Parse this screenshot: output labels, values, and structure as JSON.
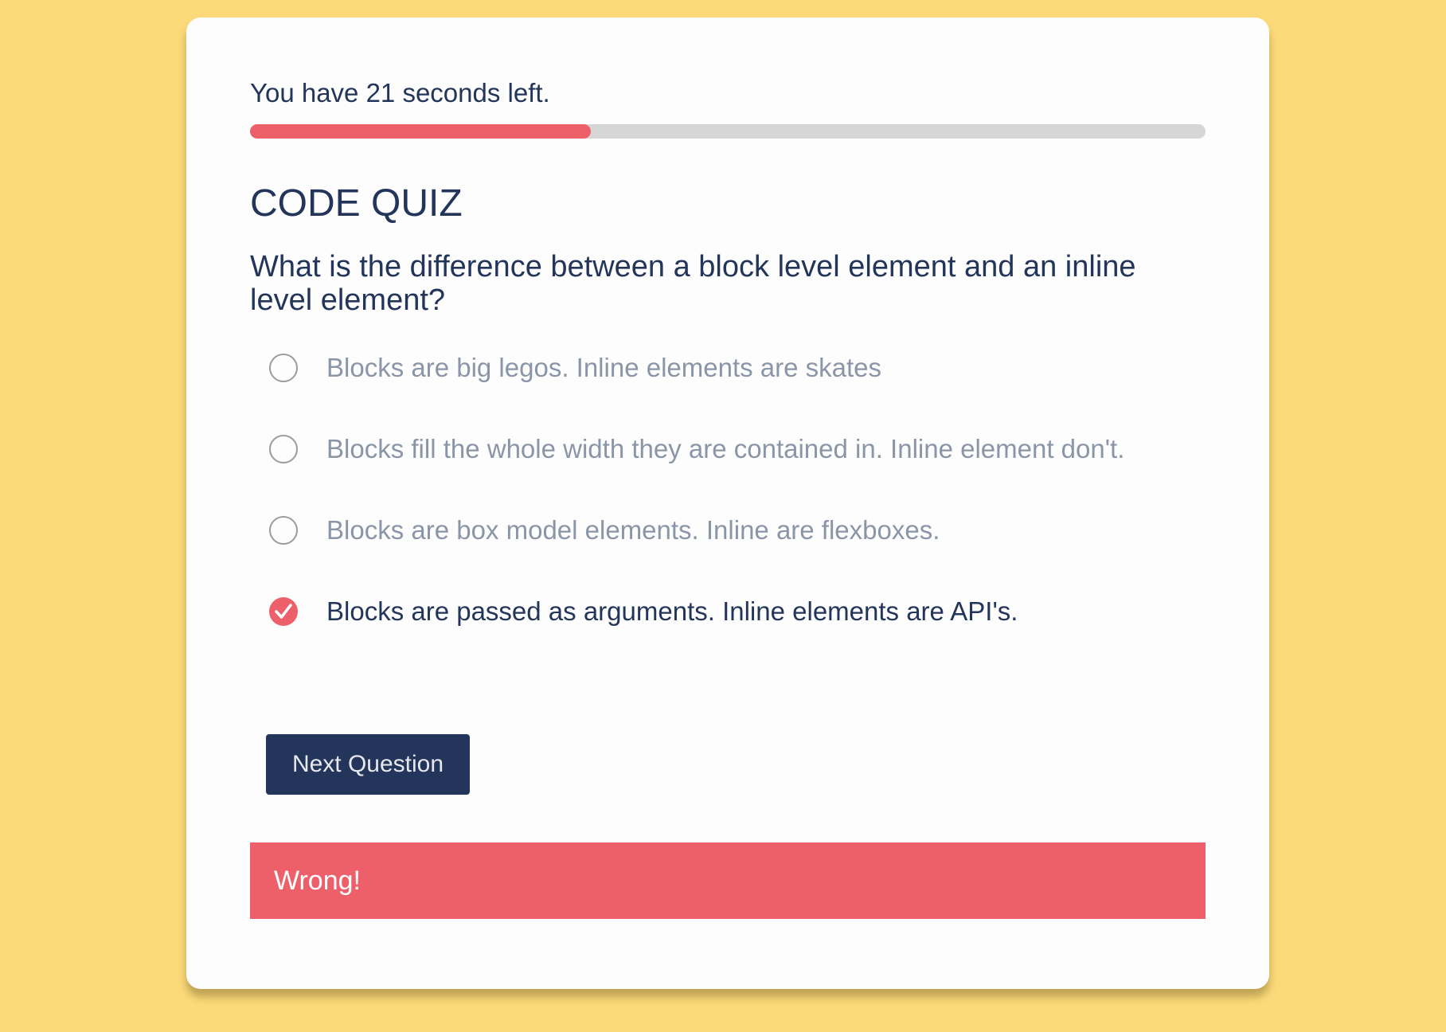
{
  "timer": {
    "text": "You have 21 seconds left.",
    "progress_fraction": 0.357
  },
  "quiz": {
    "title": "CODE QUIZ",
    "question": "What is the difference between a block level element and an inline level element?",
    "answers": [
      {
        "label": "Blocks are big legos. Inline elements are skates",
        "selected": false
      },
      {
        "label": "Blocks fill the whole width they are contained in. Inline element don't.",
        "selected": false
      },
      {
        "label": "Blocks are box model elements. Inline are flexboxes.",
        "selected": false
      },
      {
        "label": "Blocks are passed as arguments. Inline elements are API's.",
        "selected": true
      }
    ],
    "next_button_label": "Next Question"
  },
  "feedback": {
    "text": "Wrong!"
  },
  "colors": {
    "background": "#fcda7a",
    "accent": "#ed5f69",
    "primary": "#23355a",
    "muted": "#8b95a8"
  }
}
